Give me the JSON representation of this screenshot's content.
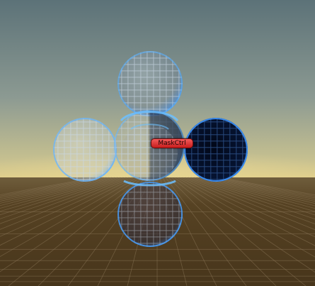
{
  "scene": {
    "label": "MaskCtrl"
  },
  "colors": {
    "sky_top": "#5f7479",
    "sky_mid": "#9aa39a",
    "horizon_glow": "#d9c98a",
    "ground": "#4e3b1f",
    "ground_far": "#6a5a3a",
    "grid_line": "#8a7658",
    "sphere_rim": "#4aa8ff",
    "label_bg": "#dc3232"
  },
  "icons": {
    "spheres": "sphere-wireframe-icon"
  }
}
